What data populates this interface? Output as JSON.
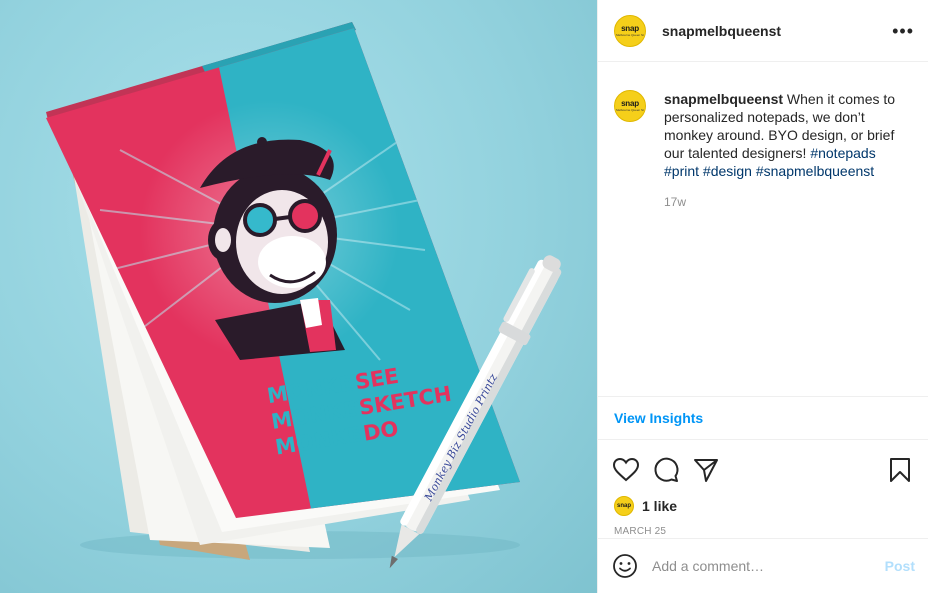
{
  "post": {
    "username": "snapmelbqueenst",
    "avatar_brand": "snap",
    "avatar_sub": "Melbourne Queen St",
    "more_label": "•••",
    "caption_text": " When it comes to personalized notepads, we don’t monkey around. BYO design, or brief our talented designers! ",
    "hashtags": [
      "#notepads",
      "#print",
      "#design",
      "#snapmelbqueenst"
    ],
    "time_ago": "17w",
    "insights_label": "View Insights",
    "likes_label": "1 like",
    "date_label": "MARCH 25",
    "comment_placeholder": "Add a comment…",
    "post_button": "Post"
  },
  "image": {
    "cover_lines": [
      {
        "left": "MONKEY",
        "right": "SEE"
      },
      {
        "left": "MONKEY",
        "right": "SKETCH"
      },
      {
        "left": "MONKEY",
        "right": "DO"
      }
    ],
    "pen_text": "Monkey Biz Studio Printz",
    "colors": {
      "background": "#93d2de",
      "cover_red": "#e3335e",
      "cover_teal": "#2fb3c5"
    }
  },
  "icons": [
    "heart-icon",
    "comment-icon",
    "share-icon",
    "bookmark-icon",
    "emoji-icon",
    "more-icon"
  ]
}
